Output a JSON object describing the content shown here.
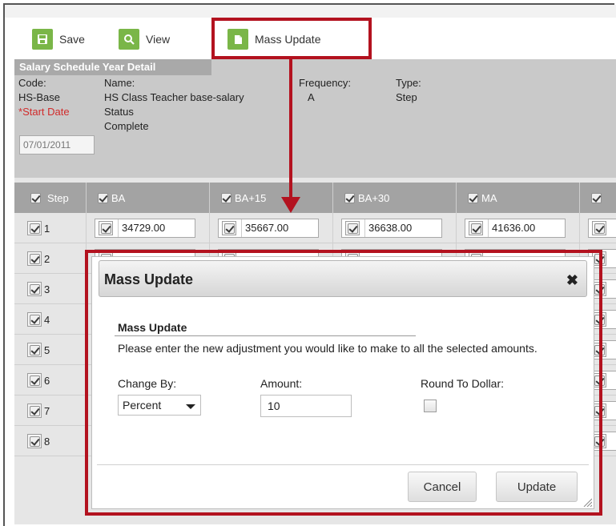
{
  "toolbar": {
    "save_label": "Save",
    "view_label": "View",
    "mass_update_label": "Mass Update"
  },
  "detail": {
    "section_title": "Salary Schedule Year Detail",
    "code_label": "Code:",
    "code_value": "HS-Base",
    "name_label": "Name:",
    "name_value": "HS Class Teacher base-salary",
    "frequency_label": "Frequency:",
    "frequency_value": "A",
    "type_label": "Type:",
    "type_value": "Step",
    "start_date_required_mark": "*",
    "start_date_label": "Start Date",
    "start_date_value": "07/01/2011",
    "status_label": "Status",
    "status_value": "Complete"
  },
  "grid": {
    "columns": [
      "Step",
      "BA",
      "BA+15",
      "BA+30",
      "MA"
    ],
    "rows": [
      {
        "step": "1",
        "values": [
          "34729.00",
          "35667.00",
          "36638.00",
          "41636.00"
        ]
      },
      {
        "step": "2",
        "values": []
      },
      {
        "step": "3",
        "values": []
      },
      {
        "step": "4",
        "values": []
      },
      {
        "step": "5",
        "values": []
      },
      {
        "step": "6",
        "values": []
      },
      {
        "step": "7",
        "values": []
      },
      {
        "step": "8",
        "values": []
      }
    ]
  },
  "modal": {
    "title": "Mass Update",
    "close_glyph": "✖",
    "section_title": "Mass Update",
    "instructions": "Please enter the new adjustment you would like to make to all the selected amounts.",
    "change_by_label": "Change By:",
    "change_by_value": "Percent",
    "amount_label": "Amount:",
    "amount_value": "10",
    "round_label": "Round To Dollar:",
    "round_checked": false,
    "cancel_label": "Cancel",
    "update_label": "Update"
  },
  "colors": {
    "accent_green": "#7ab648",
    "highlight_red": "#b3121f",
    "required_red": "#d12b2b",
    "header_gray": "#a3a3a3"
  },
  "icons": {
    "save": "save-icon",
    "view": "search-icon",
    "mass_update": "document-icon",
    "close": "close-icon"
  }
}
